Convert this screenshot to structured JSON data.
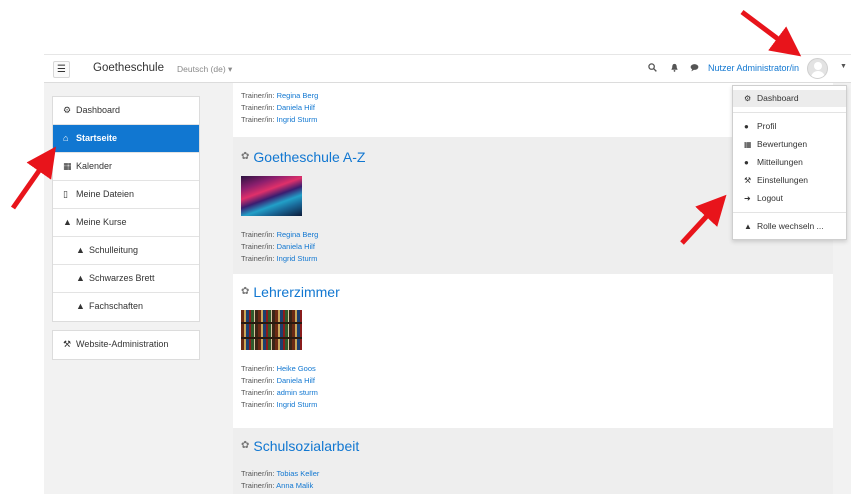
{
  "navbar": {
    "menu_icon": "hamburger-icon",
    "brand": "Goetheschule",
    "language": "Deutsch (de) ▾",
    "user_name": "Nutzer Administrator/in",
    "icons": [
      "search-icon",
      "bell-icon",
      "chat-bubble-icon",
      "user-avatar",
      "caret-down-icon"
    ]
  },
  "sidebar": {
    "group1": [
      {
        "label": "Dashboard",
        "icon": "dashboard-icon"
      },
      {
        "label": "Startseite",
        "icon": "home-icon",
        "active": true
      },
      {
        "label": "Kalender",
        "icon": "calendar-icon"
      },
      {
        "label": "Meine Dateien",
        "icon": "file-icon"
      },
      {
        "label": "Meine Kurse",
        "icon": "graduation-cap-icon"
      },
      {
        "label": "Schulleitung",
        "icon": "graduation-cap-icon"
      },
      {
        "label": "Schwarzes Brett",
        "icon": "graduation-cap-icon"
      },
      {
        "label": "Fachschaften",
        "icon": "graduation-cap-icon"
      }
    ],
    "group2": [
      {
        "label": "Website-Administration",
        "icon": "wrench-icon"
      }
    ]
  },
  "trainer_prefix": "Trainer/in:",
  "courses": [
    {
      "title": "",
      "trainers": [
        "Regina Berg",
        "Daniela Hilf",
        "Ingrid Sturm"
      ]
    },
    {
      "title": "Goetheschule A-Z",
      "image": "abstract-swirl-image",
      "trainers": [
        "Regina Berg",
        "Daniela Hilf",
        "Ingrid Sturm"
      ]
    },
    {
      "title": "Lehrerzimmer",
      "image": "bookshelf-image",
      "trainers": [
        "Heike Goos",
        "Daniela Hilf",
        "admin sturm",
        "Ingrid Sturm"
      ]
    },
    {
      "title": "Schulsozialarbeit",
      "trainers": [
        "Tobias Keller",
        "Anna Malik"
      ]
    }
  ],
  "user_menu": [
    {
      "label": "Dashboard",
      "icon": "dashboard-icon",
      "highlighted": true
    },
    {
      "label": "Profil",
      "icon": "user-icon"
    },
    {
      "label": "Bewertungen",
      "icon": "table-icon"
    },
    {
      "label": "Mitteilungen",
      "icon": "chat-bubble-icon"
    },
    {
      "label": "Einstellungen",
      "icon": "wrench-icon"
    },
    {
      "label": "Logout",
      "icon": "sign-out-icon"
    },
    {
      "label": "Rolle wechseln ...",
      "icon": "user-secret-icon"
    }
  ],
  "colors": {
    "accent": "#1177d1",
    "annotation_arrow": "#e8141b"
  }
}
